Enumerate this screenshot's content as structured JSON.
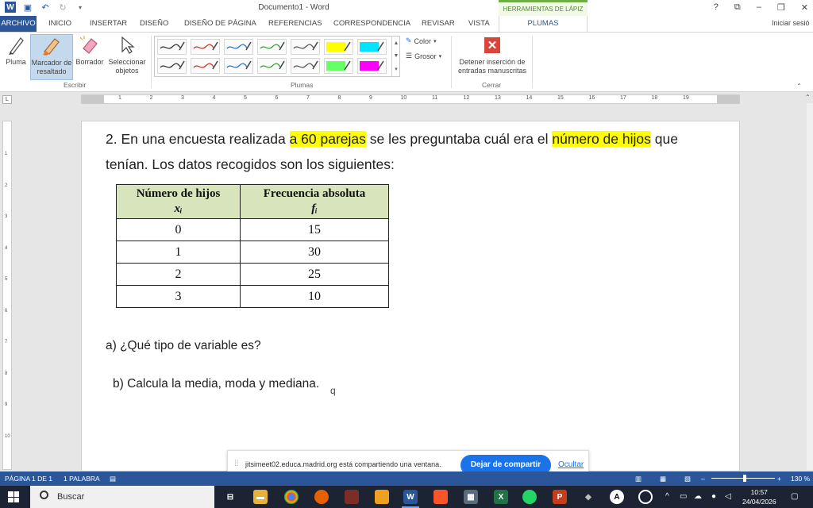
{
  "window": {
    "title": "Documento1 - Word",
    "context_header": "HERRAMIENTAS DE LÁPIZ",
    "controls": [
      "?",
      "⧉",
      "–",
      "❐",
      "✕"
    ]
  },
  "tabs": {
    "file": "ARCHIVO",
    "items": [
      "INICIO",
      "INSERTAR",
      "DISEÑO",
      "DISEÑO DE PÁGINA",
      "REFERENCIAS",
      "CORRESPONDENCIA",
      "REVISAR",
      "VISTA"
    ],
    "active": "PLUMAS",
    "signin": "Iniciar sesió"
  },
  "ribbon": {
    "escribir": {
      "label": "Escribir",
      "pluma": "Pluma",
      "marcador": "Marcador de resaltado",
      "borrador": "Borrador",
      "seleccionar": "Seleccionar objetos"
    },
    "plumas": {
      "label": "Plumas",
      "color": "Color",
      "grosor": "Grosor",
      "pen_colors": [
        "#333333",
        "#c0392b",
        "#2e75b6",
        "#3a9d3a",
        "#555555",
        "#ffff00",
        "#00e5ff",
        "#333333",
        "#c0392b",
        "#2e75b6",
        "#3a9d3a",
        "#555555",
        "#66ff66",
        "#ff00ff"
      ]
    },
    "cerrar": {
      "label": "Cerrar",
      "stop": "Detener inserción de entradas manuscritas"
    }
  },
  "document": {
    "q_prefix": "2. En una encuesta realizada ",
    "q_hl1": "a 60 parejas",
    "q_mid": " se les preguntaba cuál era el ",
    "q_hl2": "número de hijos",
    "q_end": " que",
    "q_line2": "tenían. Los datos recogidos son los siguientes:",
    "table": {
      "col1_title": "Número de hijos",
      "col1_sym": "xᵢ",
      "col2_title": "Frecuencia absoluta",
      "col2_sym": "fᵢ",
      "rows": [
        {
          "x": "0",
          "f": "15"
        },
        {
          "x": "1",
          "f": "30"
        },
        {
          "x": "2",
          "f": "25"
        },
        {
          "x": "3",
          "f": "10"
        }
      ]
    },
    "qa": "a) ¿Qué tipo de variable es?",
    "qb": "b) Calcula la media, moda y mediana.",
    "stray": "q"
  },
  "share_banner": {
    "text": "jitsimeet02.educa.madrid.org está compartiendo una ventana.",
    "stop": "Dejar de compartir",
    "hide": "Ocultar"
  },
  "status": {
    "page": "PÁGINA 1 DE 1",
    "words": "1 PALABRA",
    "zoom": "130 %"
  },
  "taskbar": {
    "search": "Buscar",
    "time": "10:57",
    "date": "24/04/2026"
  }
}
